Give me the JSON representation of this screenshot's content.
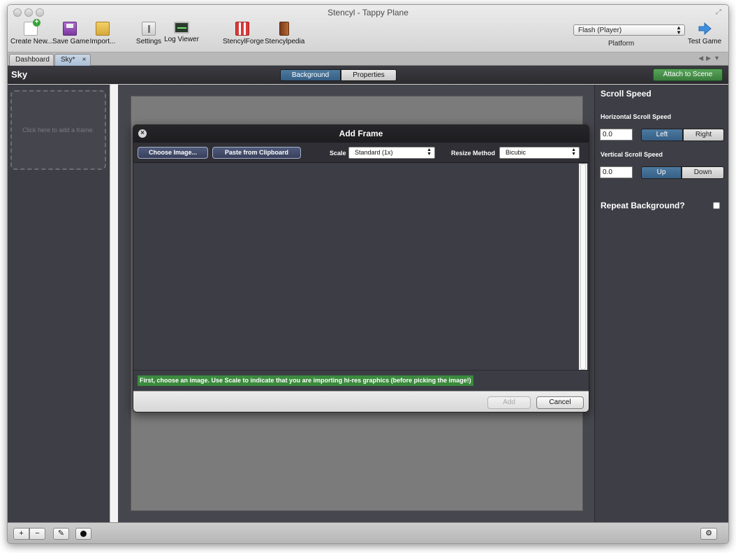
{
  "window": {
    "title": "Stencyl - Tappy Plane"
  },
  "toolbar": {
    "items": [
      {
        "label": "Create New...",
        "icon": "create-new-icon"
      },
      {
        "label": "Save Game",
        "icon": "save-icon"
      },
      {
        "label": "Import...",
        "icon": "import-icon"
      },
      {
        "label": "Settings",
        "icon": "settings-icon"
      },
      {
        "label": "Log Viewer",
        "icon": "log-viewer-icon"
      },
      {
        "label": "StencylForge",
        "icon": "store-icon"
      },
      {
        "label": "Stencylpedia",
        "icon": "book-icon"
      }
    ],
    "platform_value": "Flash (Player)",
    "platform_label": "Platform",
    "test_game_label": "Test Game"
  },
  "tabs": [
    {
      "label": "Dashboard"
    },
    {
      "label": "Sky*",
      "close": "×"
    }
  ],
  "header": {
    "title": "Sky",
    "segments": [
      "Background",
      "Properties"
    ],
    "attach_label": "Attach to Scene"
  },
  "left_panel": {
    "frame_hint": "Click here to add a frame."
  },
  "right_panel": {
    "heading": "Scroll Speed",
    "horizontal_label": "Horizontal Scroll Speed",
    "horizontal_value": "0.0",
    "horizontal_options": [
      "Left",
      "Right"
    ],
    "vertical_label": "Vertical Scroll Speed",
    "vertical_value": "0.0",
    "vertical_options": [
      "Up",
      "Down"
    ],
    "repeat_label": "Repeat Background?"
  },
  "dialog": {
    "title": "Add Frame",
    "choose_label": "Choose Image...",
    "paste_label": "Paste from Clipboard",
    "scale_label": "Scale",
    "scale_value": "Standard (1x)",
    "resize_label": "Resize Method",
    "resize_value": "Bicubic",
    "status": "First, choose an image. Use Scale to indicate that you are importing hi-res graphics (before picking the image!)",
    "add_label": "Add",
    "cancel_label": "Cancel"
  },
  "bottom_bar": {
    "plus": "+",
    "minus": "−"
  },
  "colors": {
    "accent_blue": "#3a6389",
    "attach_green": "#4a944c",
    "status_green": "#3b8a3d",
    "panel_dark": "#3e3e46"
  }
}
